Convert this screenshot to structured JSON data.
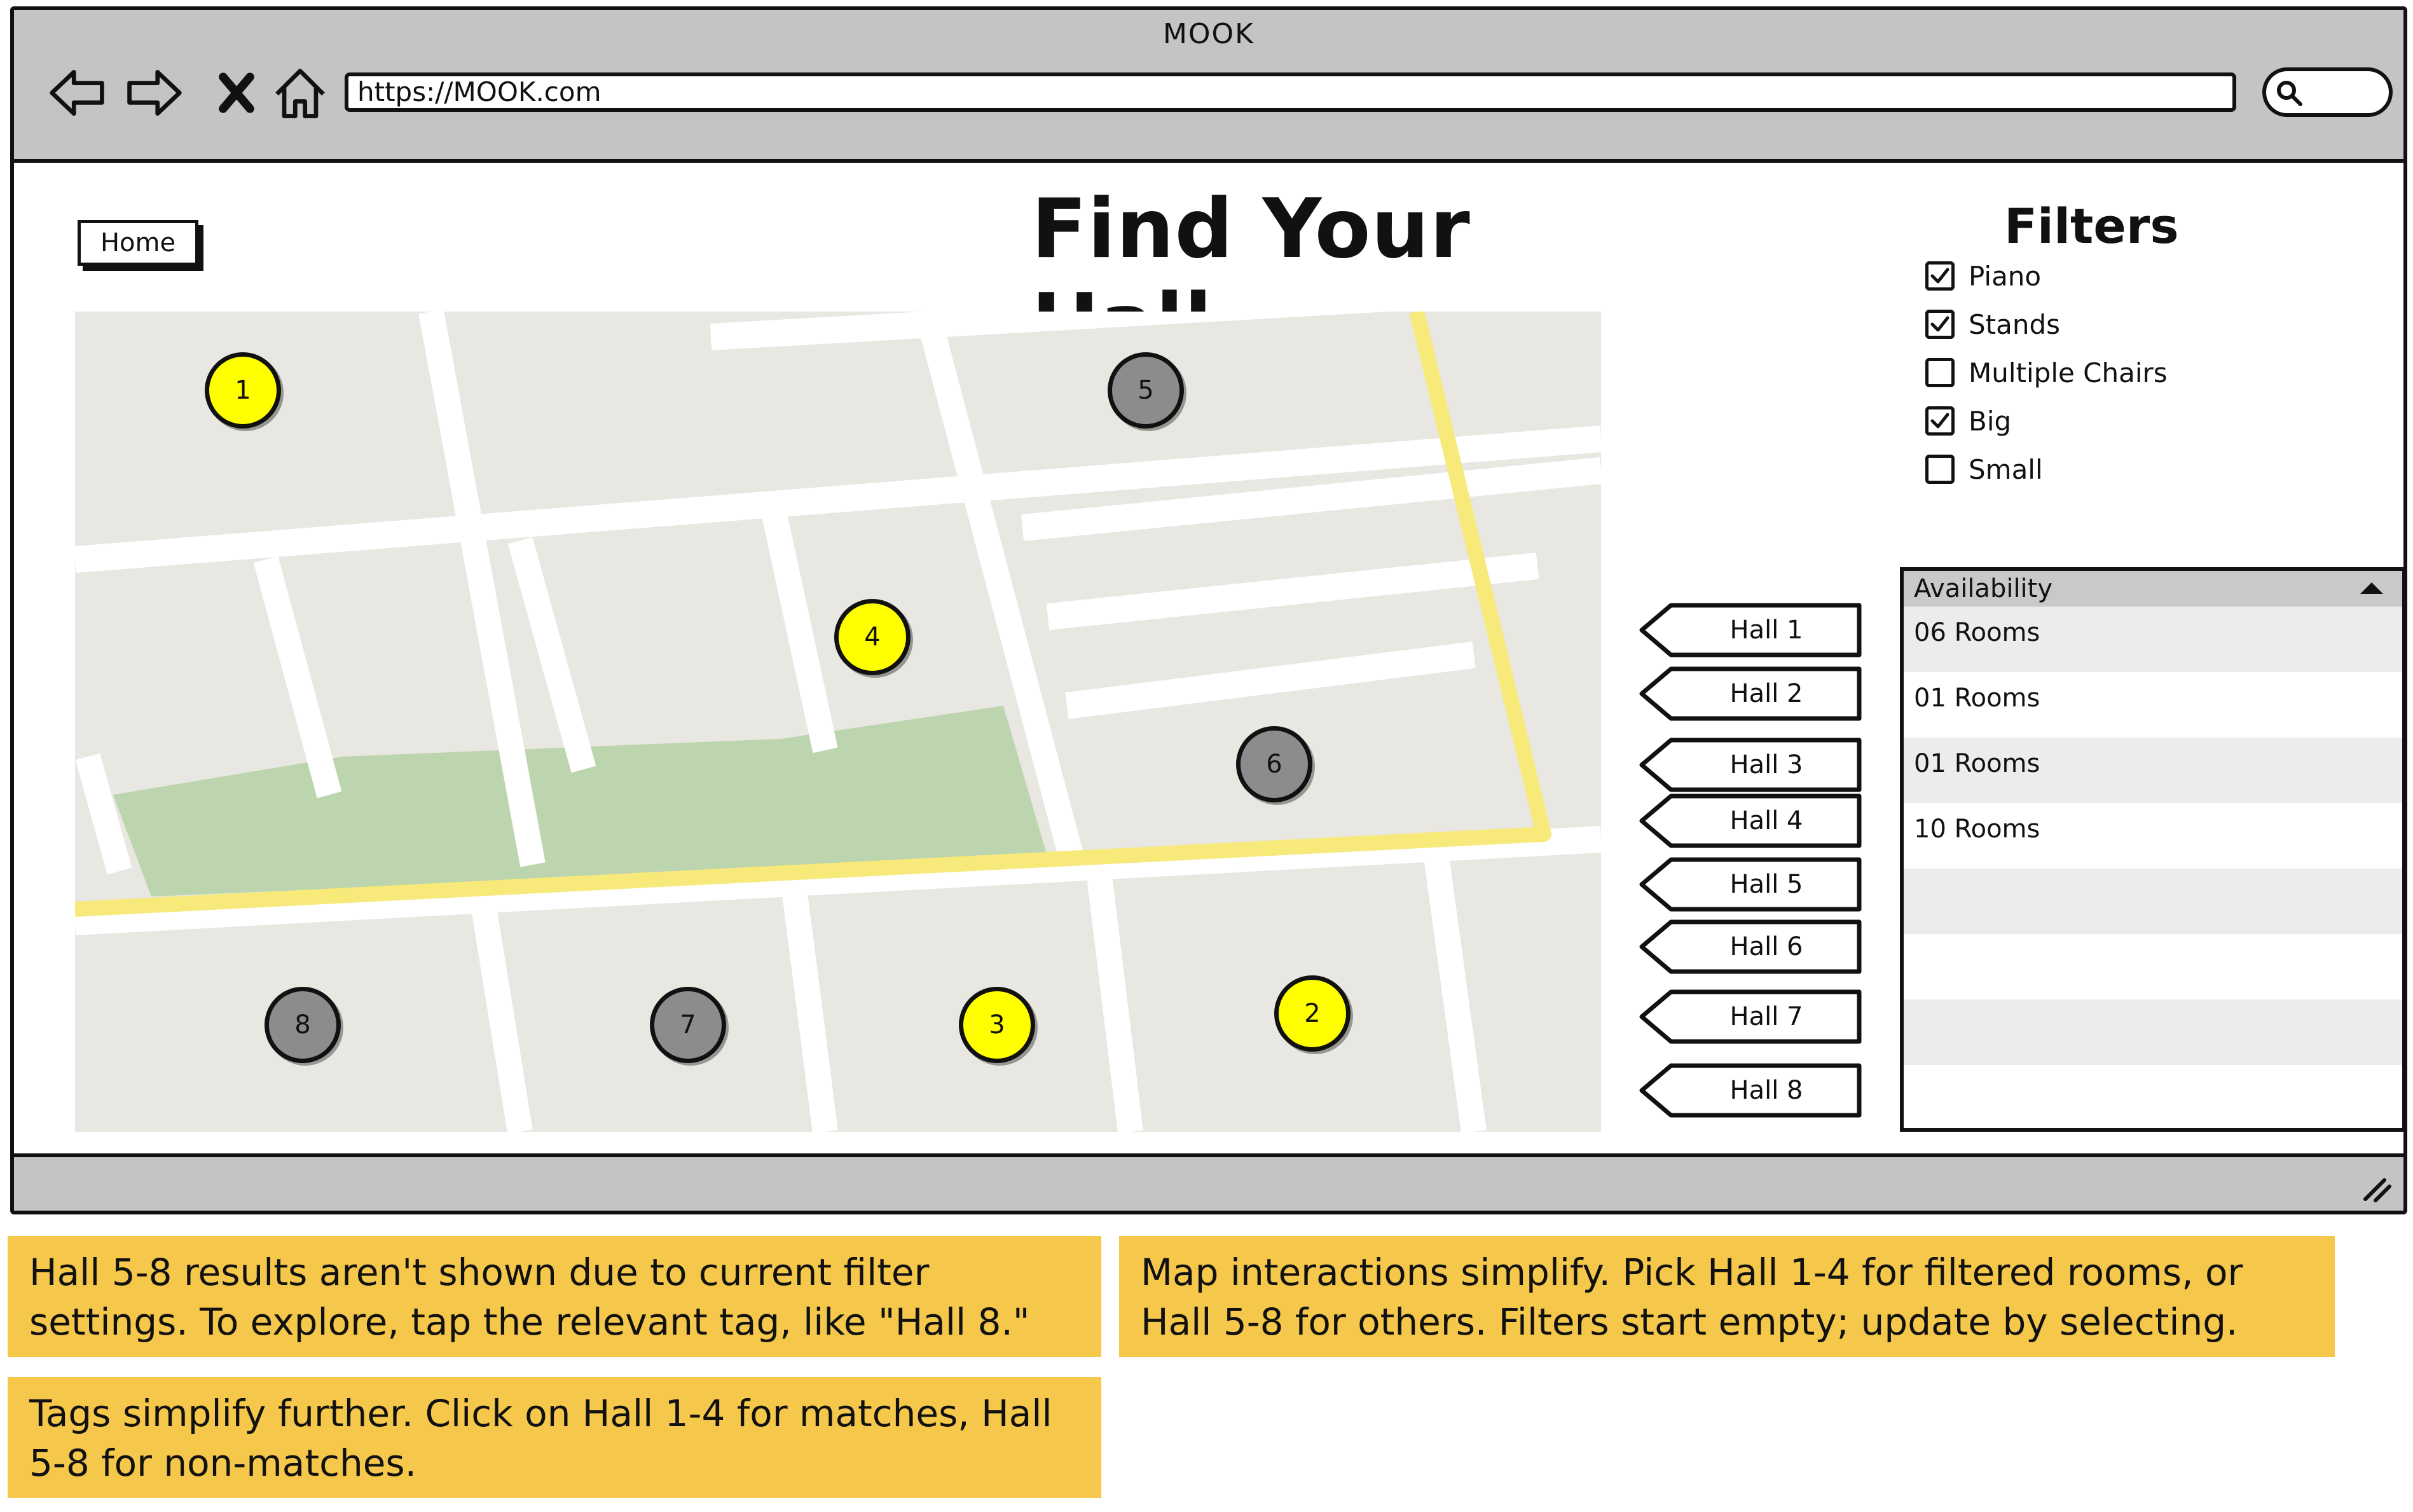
{
  "browser": {
    "title": "MOOK",
    "url": "https://MOOK.com"
  },
  "page": {
    "home_label": "Home",
    "title": "Find Your Hall"
  },
  "map": {
    "pins": [
      {
        "label": "1",
        "color": "#ffff00"
      },
      {
        "label": "5",
        "color": "#8c8c8c"
      },
      {
        "label": "4",
        "color": "#ffff00"
      },
      {
        "label": "6",
        "color": "#8c8c8c"
      },
      {
        "label": "8",
        "color": "#8c8c8c"
      },
      {
        "label": "7",
        "color": "#8c8c8c"
      },
      {
        "label": "3",
        "color": "#ffff00"
      },
      {
        "label": "2",
        "color": "#ffff00"
      }
    ]
  },
  "tags": [
    "Hall 1",
    "Hall 2",
    "Hall 3",
    "Hall 4",
    "Hall 5",
    "Hall 6",
    "Hall 7",
    "Hall 8"
  ],
  "filters": {
    "title": "Filters",
    "items": [
      {
        "label": "Piano",
        "checked": true
      },
      {
        "label": "Stands",
        "checked": true
      },
      {
        "label": "Multiple Chairs",
        "checked": false
      },
      {
        "label": "Big",
        "checked": true
      },
      {
        "label": "Small",
        "checked": false
      }
    ]
  },
  "availability": {
    "header": "Availability",
    "rows": [
      "06 Rooms",
      "01 Rooms",
      "01 Rooms",
      "10 Rooms",
      "",
      "",
      "",
      ""
    ]
  },
  "notes": [
    "Hall 5-8 results aren't shown due to current filter settings. To explore, tap the relevant tag, like \"Hall 8.\"",
    "Map interactions simplify. Pick Hall 1-4 for filtered rooms, or Hall 5-8 for others. Filters start empty; update by selecting.",
    "Tags simplify further. Click on Hall 1-4 for matches, Hall 5-8 for non-matches."
  ],
  "colors": {
    "note_bg": "#f5c74a",
    "map_bg": "#e9e7e1",
    "park": "#bcd5ae",
    "highway": "#f7ea7a",
    "pin_match": "#ffff00",
    "pin_nonmatch": "#8c8c8c"
  },
  "icons": [
    "back-arrow-icon",
    "forward-arrow-icon",
    "close-icon",
    "home-icon",
    "search-icon",
    "resize-grip-icon",
    "checkmark-icon"
  ]
}
